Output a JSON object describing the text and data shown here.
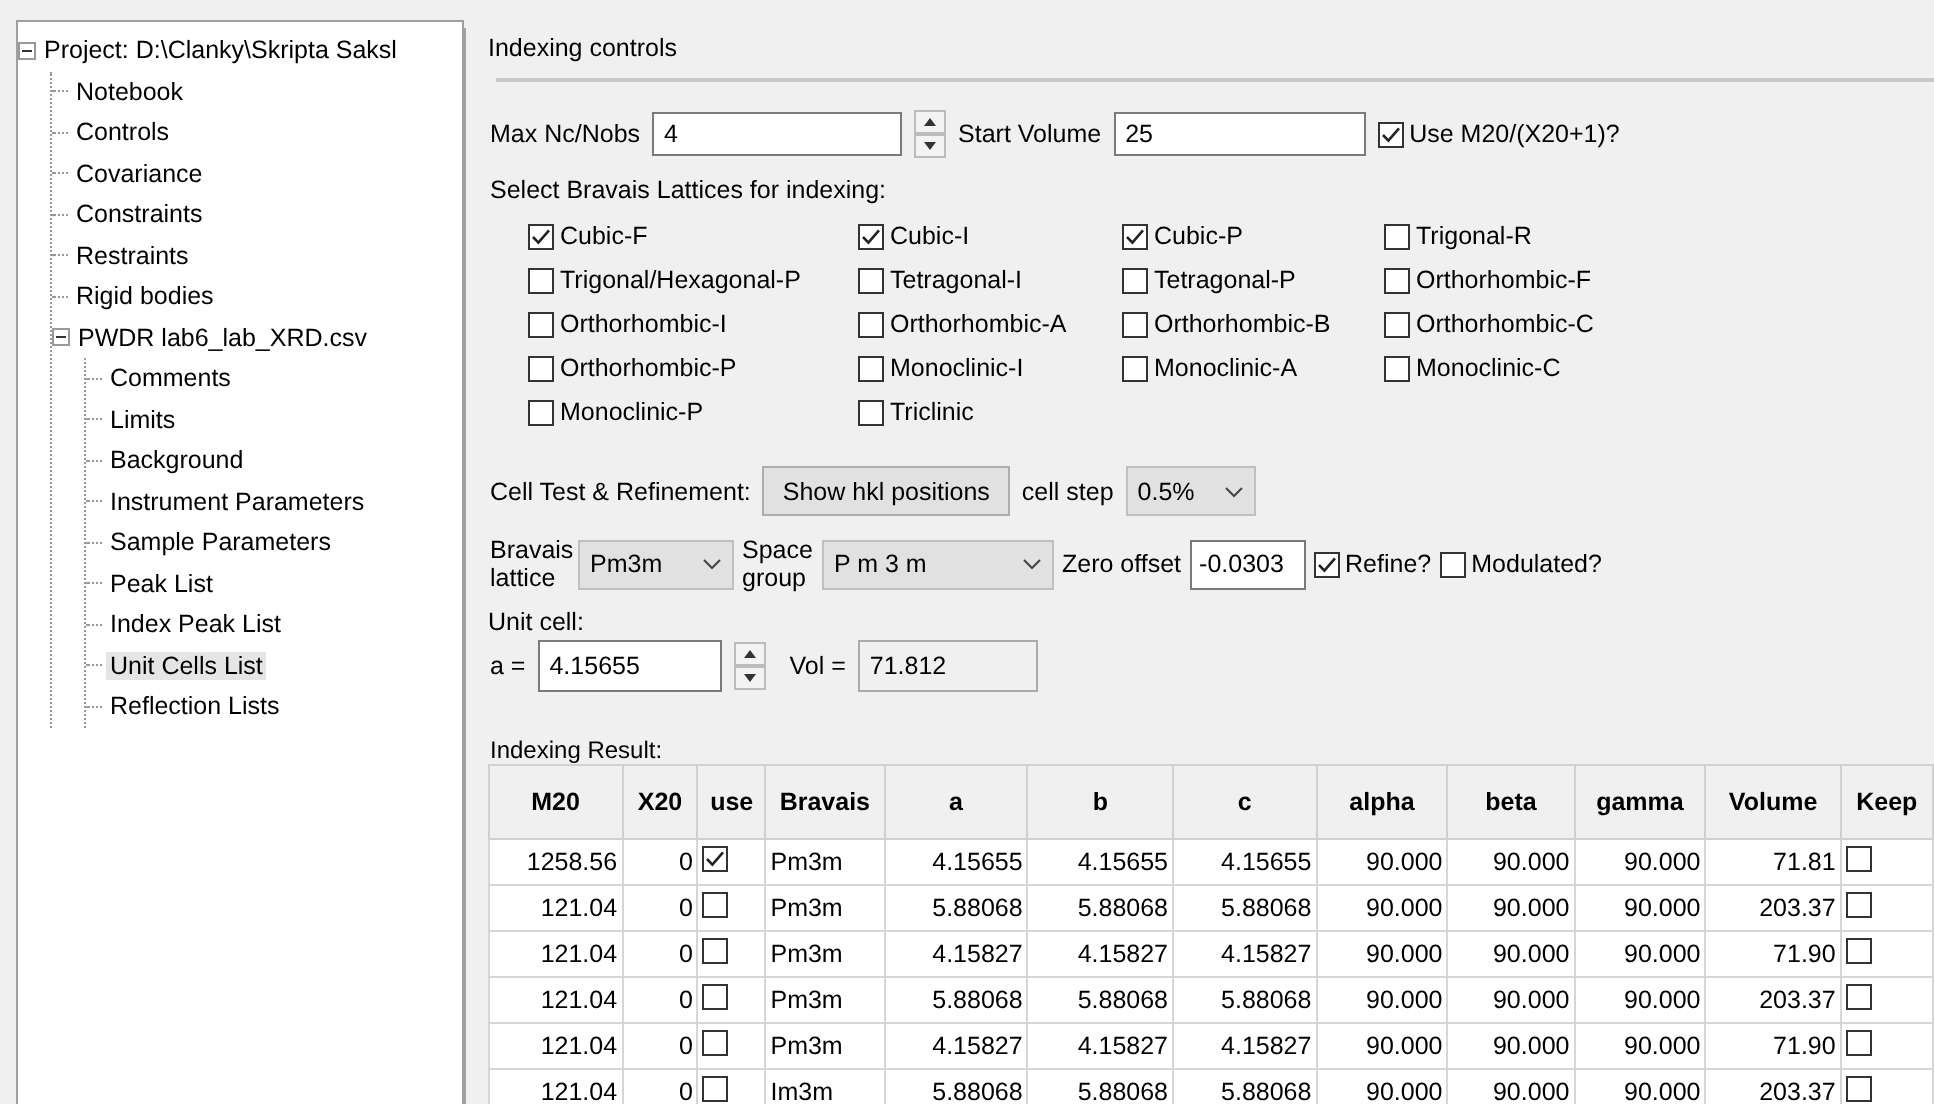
{
  "tree": [
    {
      "label": "Project: D:\\Clanky\\Skripta Saksl",
      "expanded": true,
      "selected": false,
      "children": [
        {
          "label": "Notebook",
          "selected": false
        },
        {
          "label": "Controls",
          "selected": false
        },
        {
          "label": "Covariance",
          "selected": false
        },
        {
          "label": "Constraints",
          "selected": false
        },
        {
          "label": "Restraints",
          "selected": false
        },
        {
          "label": "Rigid bodies",
          "selected": false
        },
        {
          "label": "PWDR lab6_lab_XRD.csv",
          "expanded": true,
          "selected": false,
          "children": [
            {
              "label": "Comments",
              "selected": false
            },
            {
              "label": "Limits",
              "selected": false
            },
            {
              "label": "Background",
              "selected": false
            },
            {
              "label": "Instrument Parameters",
              "selected": false
            },
            {
              "label": "Sample Parameters",
              "selected": false
            },
            {
              "label": "Peak List",
              "selected": false
            },
            {
              "label": "Index Peak List",
              "selected": false
            },
            {
              "label": "Unit Cells List",
              "selected": true
            },
            {
              "label": "Reflection Lists",
              "selected": false
            }
          ]
        }
      ]
    }
  ],
  "panel_title": "Indexing controls",
  "max_nc": {
    "label": "Max Nc/Nobs",
    "value": "4"
  },
  "start_volume": {
    "label": "Start Volume",
    "value": "25"
  },
  "use_m20": {
    "label": "Use M20/(X20+1)?",
    "checked": true
  },
  "lattice_heading": "Select Bravais Lattices for indexing:",
  "lattices": [
    {
      "label": "Cubic-F",
      "checked": true
    },
    {
      "label": "Cubic-I",
      "checked": true
    },
    {
      "label": "Cubic-P",
      "checked": true
    },
    {
      "label": "Trigonal-R",
      "checked": false
    },
    {
      "label": "Trigonal/Hexagonal-P",
      "checked": false
    },
    {
      "label": "Tetragonal-I",
      "checked": false
    },
    {
      "label": "Tetragonal-P",
      "checked": false
    },
    {
      "label": "Orthorhombic-F",
      "checked": false
    },
    {
      "label": "Orthorhombic-I",
      "checked": false
    },
    {
      "label": "Orthorhombic-A",
      "checked": false
    },
    {
      "label": "Orthorhombic-B",
      "checked": false
    },
    {
      "label": "Orthorhombic-C",
      "checked": false
    },
    {
      "label": "Orthorhombic-P",
      "checked": false
    },
    {
      "label": "Monoclinic-I",
      "checked": false
    },
    {
      "label": "Monoclinic-A",
      "checked": false
    },
    {
      "label": "Monoclinic-C",
      "checked": false
    },
    {
      "label": "Monoclinic-P",
      "checked": false
    },
    {
      "label": "Triclinic",
      "checked": false
    }
  ],
  "cell_test": {
    "label": "Cell Test & Refinement:",
    "button": "Show hkl positions",
    "step_label": "cell step",
    "step_value": "0.5%"
  },
  "bravais": {
    "label": "Bravais lattice",
    "value": "Pm3m"
  },
  "space_group": {
    "label": "Space group",
    "value": "P m 3 m"
  },
  "zero_offset": {
    "label": "Zero offset",
    "value": "-0.0303"
  },
  "refine": {
    "label": "Refine?",
    "checked": true
  },
  "modulated": {
    "label": "Modulated?",
    "checked": false
  },
  "unit_cell": {
    "heading": "Unit cell:",
    "a_label": "a =",
    "a_value": "4.15655",
    "vol_label": "Vol =",
    "vol_value": "71.812"
  },
  "results": {
    "heading": "Indexing Result:",
    "columns": [
      "M20",
      "X20",
      "use",
      "Bravais",
      "a",
      "b",
      "c",
      "alpha",
      "beta",
      "gamma",
      "Volume",
      "Keep"
    ],
    "rows": [
      {
        "m20": "1258.56",
        "x20": "0",
        "use": true,
        "bravais": "Pm3m",
        "a": "4.15655",
        "b": "4.15655",
        "c": "4.15655",
        "alpha": "90.000",
        "beta": "90.000",
        "gamma": "90.000",
        "volume": "71.81",
        "keep": false
      },
      {
        "m20": "121.04",
        "x20": "0",
        "use": false,
        "bravais": "Pm3m",
        "a": "5.88068",
        "b": "5.88068",
        "c": "5.88068",
        "alpha": "90.000",
        "beta": "90.000",
        "gamma": "90.000",
        "volume": "203.37",
        "keep": false
      },
      {
        "m20": "121.04",
        "x20": "0",
        "use": false,
        "bravais": "Pm3m",
        "a": "4.15827",
        "b": "4.15827",
        "c": "4.15827",
        "alpha": "90.000",
        "beta": "90.000",
        "gamma": "90.000",
        "volume": "71.90",
        "keep": false
      },
      {
        "m20": "121.04",
        "x20": "0",
        "use": false,
        "bravais": "Pm3m",
        "a": "5.88068",
        "b": "5.88068",
        "c": "5.88068",
        "alpha": "90.000",
        "beta": "90.000",
        "gamma": "90.000",
        "volume": "203.37",
        "keep": false
      },
      {
        "m20": "121.04",
        "x20": "0",
        "use": false,
        "bravais": "Pm3m",
        "a": "4.15827",
        "b": "4.15827",
        "c": "4.15827",
        "alpha": "90.000",
        "beta": "90.000",
        "gamma": "90.000",
        "volume": "71.90",
        "keep": false
      },
      {
        "m20": "121.04",
        "x20": "0",
        "use": false,
        "bravais": "Im3m",
        "a": "5.88068",
        "b": "5.88068",
        "c": "5.88068",
        "alpha": "90.000",
        "beta": "90.000",
        "gamma": "90.000",
        "volume": "203.37",
        "keep": false
      }
    ]
  }
}
